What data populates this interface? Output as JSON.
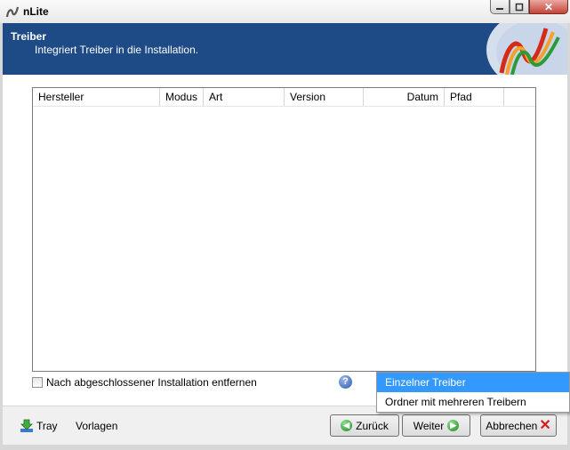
{
  "window": {
    "title": "nLite",
    "close_glyph": "✕"
  },
  "header": {
    "title": "Treiber",
    "subtitle": "Integriert Treiber in die Installation."
  },
  "drivers_table": {
    "columns": [
      {
        "label": "Hersteller",
        "align": "left"
      },
      {
        "label": "Modus",
        "align": "left"
      },
      {
        "label": "Art",
        "align": "left"
      },
      {
        "label": "Version",
        "align": "left"
      },
      {
        "label": "Datum",
        "align": "right"
      },
      {
        "label": "Pfad",
        "align": "left"
      }
    ],
    "rows": []
  },
  "options": {
    "remove_after_install_label": "Nach abgeschlossener Installation entfernen",
    "checked": false
  },
  "help": {
    "glyph": "?"
  },
  "bottom": {
    "tray_label": "Tray",
    "presets_label": "Vorlagen"
  },
  "buttons": {
    "back_label": "Zurück",
    "next_label": "Weiter",
    "cancel_label": "Abbrechen"
  },
  "popup_menu": {
    "items": [
      "Einzelner Treiber",
      "Ordner mit mehreren Treibern"
    ],
    "highlighted": 0
  },
  "colors": {
    "header_bg": "#1e4a86",
    "menu_highlight": "#3399ff"
  }
}
